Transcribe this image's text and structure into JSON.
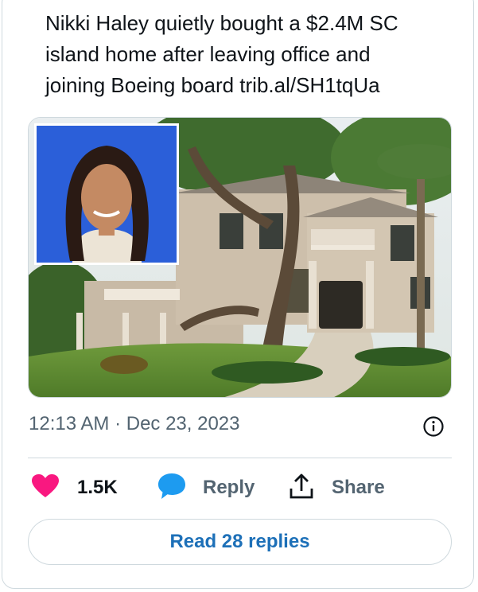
{
  "tweet": {
    "text": "Nikki Haley quietly bought a $2.4M SC\nisland home after leaving office and\njoining Boeing board trib.al/SH1tqUa",
    "timestamp": "12:13 AM · Dec 23, 2023"
  },
  "actions": {
    "likes": "1.5K",
    "reply_label": "Reply",
    "share_label": "Share"
  },
  "read_replies_label": "Read 28 replies",
  "colors": {
    "heart": "#f91880",
    "reply_bubble": "#1d9bf0",
    "link_text": "#1d70b8"
  },
  "icons": {
    "heart": "heart-icon",
    "reply": "reply-bubble-icon",
    "share": "share-icon",
    "info": "info-icon"
  }
}
